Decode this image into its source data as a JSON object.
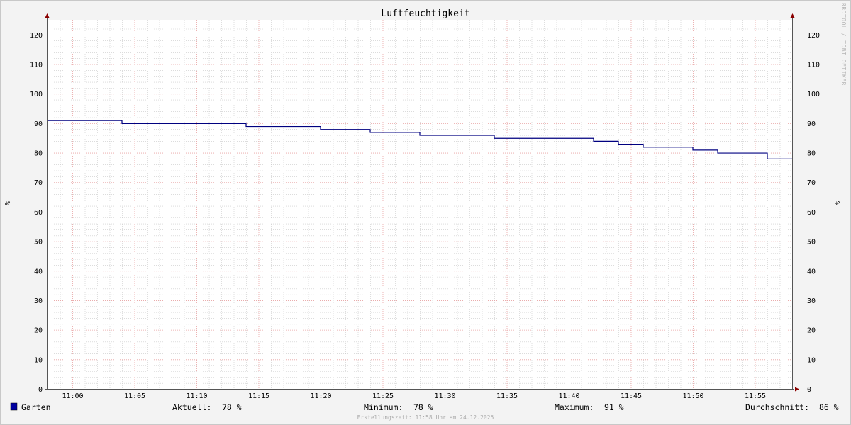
{
  "chart_data": {
    "type": "line",
    "title": "Luftfeuchtigkeit",
    "ylabel": "%",
    "ylabel_right": "%",
    "ylim": [
      0,
      125
    ],
    "yticks": [
      0,
      10,
      20,
      30,
      40,
      50,
      60,
      70,
      80,
      90,
      100,
      110,
      120
    ],
    "xlim": [
      "10:58",
      "11:58"
    ],
    "xticks": [
      "11:00",
      "11:05",
      "11:10",
      "11:15",
      "11:20",
      "11:25",
      "11:30",
      "11:35",
      "11:40",
      "11:45",
      "11:50",
      "11:55"
    ],
    "grid": true,
    "series": [
      {
        "name": "Garten",
        "color": "#000080",
        "step": true,
        "x": [
          "10:58",
          "11:04",
          "11:14",
          "11:20",
          "11:24",
          "11:28",
          "11:30",
          "11:34",
          "11:42",
          "11:44",
          "11:46",
          "11:50",
          "11:52",
          "11:54",
          "11:56",
          "11:58"
        ],
        "values": [
          91,
          90,
          89,
          88,
          87,
          86,
          86,
          85,
          84,
          83,
          82,
          81,
          80,
          80,
          78,
          78
        ]
      }
    ]
  },
  "watermark": "RRDTOOL / TOBI OETIKER",
  "legend": {
    "series_name": "Garten",
    "swatch_color": "#0000a0",
    "aktuell_label": "Aktuell:",
    "aktuell_value": "78 %",
    "minimum_label": "Minimum:",
    "minimum_value": "78 %",
    "maximum_label": "Maximum:",
    "maximum_value": "91 %",
    "durchschnitt_label": "Durchschnitt:",
    "durchschnitt_value": "86 %"
  },
  "footer": "Erstellungszeit: 11:58 Uhr am 24.12.2025",
  "colors": {
    "background": "#f3f3f3",
    "canvas": "#ffffff",
    "major_grid": "#e8a0a0",
    "minor_grid": "#c8c8c8",
    "arrow": "#8b0000"
  }
}
